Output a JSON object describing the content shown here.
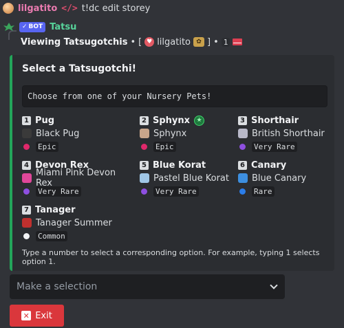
{
  "reply": {
    "username": "lilgatito",
    "command_icon": "</>",
    "command_text": "t!dc edit storey"
  },
  "author": {
    "bot_badge": "BOT",
    "name": "Tatsu"
  },
  "viewing": {
    "title": "Viewing Tatsugotchis",
    "bullet": "•",
    "open_bracket": "[",
    "user": "lilgatito",
    "close_bracket": "]",
    "count": "1"
  },
  "embed": {
    "accent_color": "#23a55a",
    "title": "Select a Tatsugotchi!",
    "code_text": "Choose from one of your Nursery Pets!",
    "footer": "Type a number to select a corresponding option. For example, typing 1 selects option 1."
  },
  "pets": [
    {
      "number": "1",
      "name": "Pug",
      "variant": "Black Pug",
      "rarity": "Epic",
      "rarity_color": "#e0286b",
      "sprite_color": "#3a3a3a",
      "icon": "black-pug-sprite-icon"
    },
    {
      "number": "2",
      "name": "Sphynx",
      "variant": "Sphynx",
      "rarity": "Epic",
      "rarity_color": "#e0286b",
      "sprite_color": "#c9a58a",
      "icon": "sphynx-sprite-icon",
      "badge": "★"
    },
    {
      "number": "3",
      "name": "Shorthair",
      "variant": "British Shorthair",
      "rarity": "Very Rare",
      "rarity_color": "#8e4fe0",
      "sprite_color": "#b8b8c8",
      "icon": "british-shorthair-sprite-icon"
    },
    {
      "number": "4",
      "name": "Devon Rex",
      "variant": "Miami Pink Devon Rex",
      "rarity": "Very Rare",
      "rarity_color": "#8e4fe0",
      "sprite_color": "#e0479a",
      "icon": "miami-pink-devon-rex-sprite-icon"
    },
    {
      "number": "5",
      "name": "Blue Korat",
      "variant": "Pastel Blue Korat",
      "rarity": "Very Rare",
      "rarity_color": "#8e4fe0",
      "sprite_color": "#9fc6e6",
      "icon": "pastel-blue-korat-sprite-icon"
    },
    {
      "number": "6",
      "name": "Canary",
      "variant": "Blue Canary",
      "rarity": "Rare",
      "rarity_color": "#2b7de9",
      "sprite_color": "#3d8fe0",
      "icon": "blue-canary-sprite-icon"
    },
    {
      "number": "7",
      "name": "Tanager",
      "variant": "Tanager Summer",
      "rarity": "Common",
      "rarity_color": "#f2f3f5",
      "sprite_color": "#c0302e",
      "icon": "summer-tanager-sprite-icon"
    }
  ],
  "select": {
    "placeholder": "Make a selection"
  },
  "exit_button": {
    "label": "Exit",
    "color": "#da373c"
  }
}
